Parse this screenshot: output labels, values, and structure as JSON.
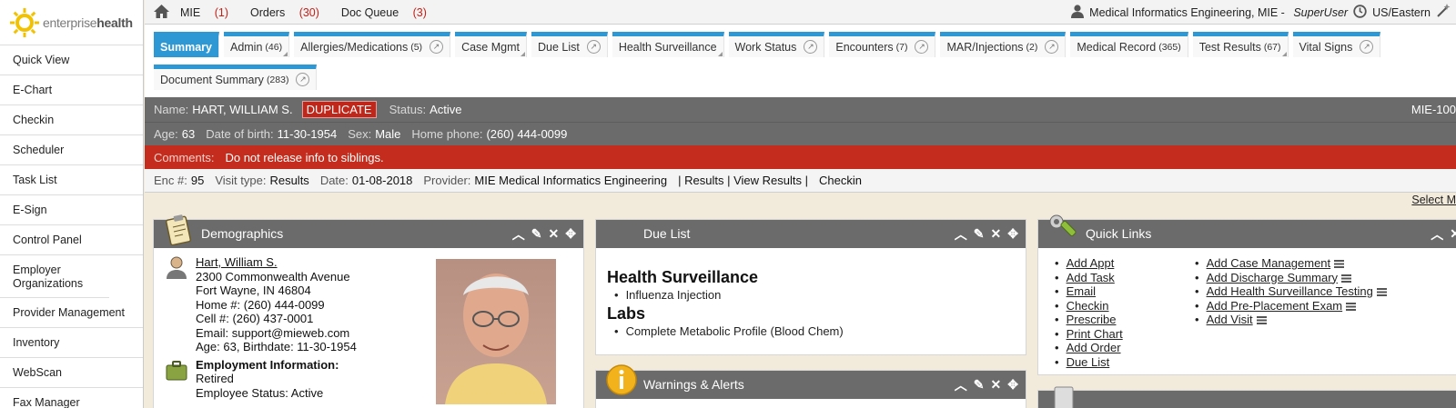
{
  "sidebar": {
    "logo_light": "enterprise",
    "logo_bold": "health",
    "items": [
      "Quick View",
      "E-Chart",
      "Checkin",
      "Scheduler",
      "Task List",
      "E-Sign",
      "Control Panel",
      "Employer Organizations",
      "Provider Management",
      "Inventory",
      "WebScan",
      "Fax Manager"
    ]
  },
  "topnav": {
    "mie_label": "MIE",
    "mie_count": "(1)",
    "orders_label": "Orders",
    "orders_count": "(30)",
    "docqueue_label": "Doc Queue",
    "docqueue_count": "(3)",
    "user": "Medical Informatics Engineering, MIE -",
    "role": "SuperUser",
    "timezone": "US/Eastern"
  },
  "tabs": {
    "row1": [
      {
        "label": "Summary",
        "count": ""
      },
      {
        "label": "Admin",
        "count": "(46)"
      },
      {
        "label": "Allergies/Medications",
        "count": "(5)"
      },
      {
        "label": "Case Mgmt",
        "count": ""
      },
      {
        "label": "Due List",
        "count": ""
      },
      {
        "label": "Health Surveillance",
        "count": ""
      },
      {
        "label": "Work Status",
        "count": ""
      },
      {
        "label": "Encounters",
        "count": "(7)"
      },
      {
        "label": "MAR/Injections",
        "count": "(2)"
      },
      {
        "label": "Medical Record",
        "count": "(365)"
      },
      {
        "label": "Test Results",
        "count": "(67)"
      },
      {
        "label": "Vital Signs",
        "count": ""
      }
    ],
    "row2": [
      {
        "label": "Document Summary",
        "count": "(283)"
      }
    ]
  },
  "patient": {
    "name_label": "Name:",
    "name": "HART, WILLIAM S.",
    "duplicate": "DUPLICATE",
    "status_label": "Status:",
    "status": "Active",
    "mrn": "MIE-100",
    "age_label": "Age:",
    "age": "63",
    "dob_label": "Date of birth:",
    "dob": "11-30-1954",
    "sex_label": "Sex:",
    "sex": "Male",
    "phone_label": "Home phone:",
    "phone": "(260) 444-0099",
    "comments_label": "Comments:",
    "comments": "Do not release info to siblings."
  },
  "encounter": {
    "enc_label": "Enc #:",
    "enc": "95",
    "visit_label": "Visit type:",
    "visit": "Results",
    "date_label": "Date:",
    "date": "01-08-2018",
    "provider_label": "Provider:",
    "provider": "MIE Medical Informatics Engineering",
    "links": "| Results | View Results |",
    "checkin": "Checkin"
  },
  "select_label": "Select M",
  "demographics": {
    "title": "Demographics",
    "name": "Hart, William S.",
    "addr1": "2300 Commonwealth Avenue",
    "addr2": "Fort Wayne, IN 46804",
    "home": "Home #: (260) 444-0099",
    "cell": "Cell #: (260) 437-0001",
    "email": "Email: support@mieweb.com",
    "age": "Age: 63, Birthdate: 11-30-1954",
    "emp_title": "Employment Information:",
    "emp_status": "Retired",
    "emp_active": "Employee Status: Active"
  },
  "duelist": {
    "title": "Due List",
    "sections": [
      {
        "heading": "Health Surveillance",
        "items": [
          "Influenza Injection"
        ]
      },
      {
        "heading": "Labs",
        "items": [
          "Complete Metabolic Profile (Blood Chem)"
        ]
      }
    ]
  },
  "warnings": {
    "title": "Warnings & Alerts"
  },
  "quicklinks": {
    "title": "Quick Links",
    "col1": [
      "Add Appt",
      "Add Task",
      "Email",
      "Checkin",
      "Prescribe",
      "Print Chart",
      "Add Order",
      "Due List"
    ],
    "col2": [
      "Add Case Management",
      "Add Discharge Summary",
      "Add Health Surveillance Testing",
      "Add Pre-Placement Exam",
      "Add Visit"
    ]
  },
  "colors": {
    "accent": "#2d98d4",
    "bar": "#6b6b6b",
    "alert": "#c42d1d"
  }
}
